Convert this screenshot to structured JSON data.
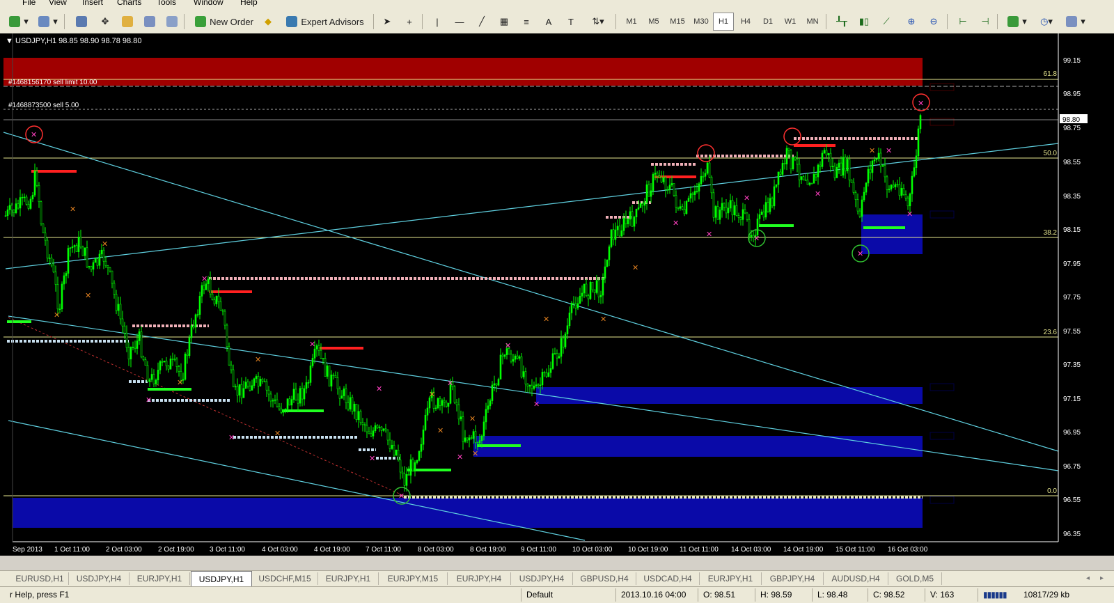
{
  "menu": [
    "File",
    "View",
    "Insert",
    "Charts",
    "Tools",
    "Window",
    "Help"
  ],
  "toolbar": {
    "new_order": "New Order",
    "expert_advisors": "Expert Advisors",
    "timeframes": [
      "M1",
      "M5",
      "M15",
      "M30",
      "H1",
      "H4",
      "D1",
      "W1",
      "MN"
    ],
    "active_timeframe": "H1"
  },
  "chart": {
    "header": "USDJPY,H1  98.85 98.90 98.78 98.80",
    "current_price": "98.80",
    "order_1": "#1468156170 sell limit 10.00",
    "order_2": "#1468873500 sell 5.00",
    "price_levels": [
      "99.15",
      "98.95",
      "98.75",
      "98.55",
      "98.35",
      "98.15",
      "97.95",
      "97.75",
      "97.55",
      "97.35",
      "97.15",
      "96.95",
      "96.75",
      "96.55",
      "96.35"
    ],
    "fib_labels": [
      "61.8",
      "50.0",
      "38.2",
      "23.6",
      "0.0"
    ],
    "time_labels": [
      "Sep 2013",
      "1 Oct 11:00",
      "2 Oct 03:00",
      "2 Oct 19:00",
      "3 Oct 11:00",
      "4 Oct 03:00",
      "4 Oct 19:00",
      "7 Oct 11:00",
      "8 Oct 03:00",
      "8 Oct 19:00",
      "9 Oct 11:00",
      "10 Oct 03:00",
      "10 Oct 19:00",
      "11 Oct 11:00",
      "14 Oct 03:00",
      "14 Oct 19:00",
      "15 Oct 11:00",
      "16 Oct 03:00"
    ],
    "colors": {
      "background": "#000000",
      "candle": "#00ff00",
      "axis": "#ffffff",
      "fib": "#ffff80",
      "trend": "#5fd0e0",
      "supply": "#a00000",
      "demand": "#0a0aa8"
    }
  },
  "tabs": [
    "EURUSD,H1",
    "USDJPY,H4",
    "EURJPY,H1",
    "USDJPY,H1",
    "USDCHF,M15",
    "EURJPY,H1",
    "EURJPY,M15",
    "EURJPY,H4",
    "USDJPY,H4",
    "GBPUSD,H4",
    "USDCAD,H4",
    "EURJPY,H1",
    "GBPJPY,H4",
    "AUDUSD,H4",
    "GOLD,M5"
  ],
  "active_tab": "USDJPY,H1",
  "status": {
    "help": "r Help, press F1",
    "profile": "Default",
    "datetime": "2013.10.16 04:00",
    "open": "O: 98.51",
    "high": "H: 98.59",
    "low": "L: 98.48",
    "close": "C: 98.52",
    "volume": "V: 163",
    "traffic": "10817/29 kb"
  }
}
